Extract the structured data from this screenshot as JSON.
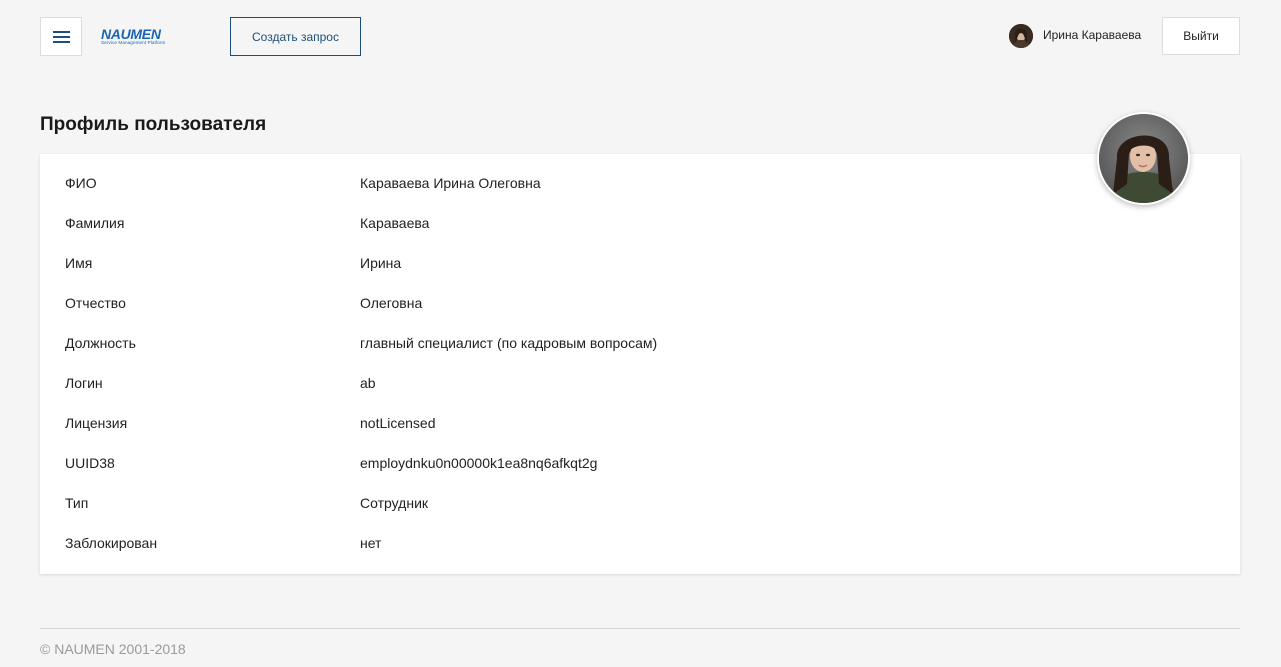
{
  "header": {
    "logo_text": "NAUMEN",
    "logo_subtitle": "Service Management Platform",
    "create_button_label": "Создать запрос",
    "user_name": "Ирина Караваева",
    "logout_label": "Выйти"
  },
  "page": {
    "title": "Профиль пользователя"
  },
  "profile_rows": [
    {
      "label": "ФИО",
      "value": "Караваева Ирина Олеговна"
    },
    {
      "label": "Фамилия",
      "value": "Караваева"
    },
    {
      "label": "Имя",
      "value": "Ирина"
    },
    {
      "label": "Отчество",
      "value": "Олеговна"
    },
    {
      "label": "Должность",
      "value": "главный специалист (по кадровым вопросам)"
    },
    {
      "label": "Логин",
      "value": "ab"
    },
    {
      "label": "Лицензия",
      "value": "notLicensed"
    },
    {
      "label": "UUID38",
      "value": "employdnku0n00000k1ea8nq6afkqt2g"
    },
    {
      "label": "Тип",
      "value": "Сотрудник"
    },
    {
      "label": "Заблокирован",
      "value": "нет"
    }
  ],
  "footer": {
    "copyright": "© NAUMEN 2001-2018"
  },
  "colors": {
    "accent": "#1d4f7a",
    "logo": "#1a66b3",
    "background": "#f5f5f5"
  }
}
